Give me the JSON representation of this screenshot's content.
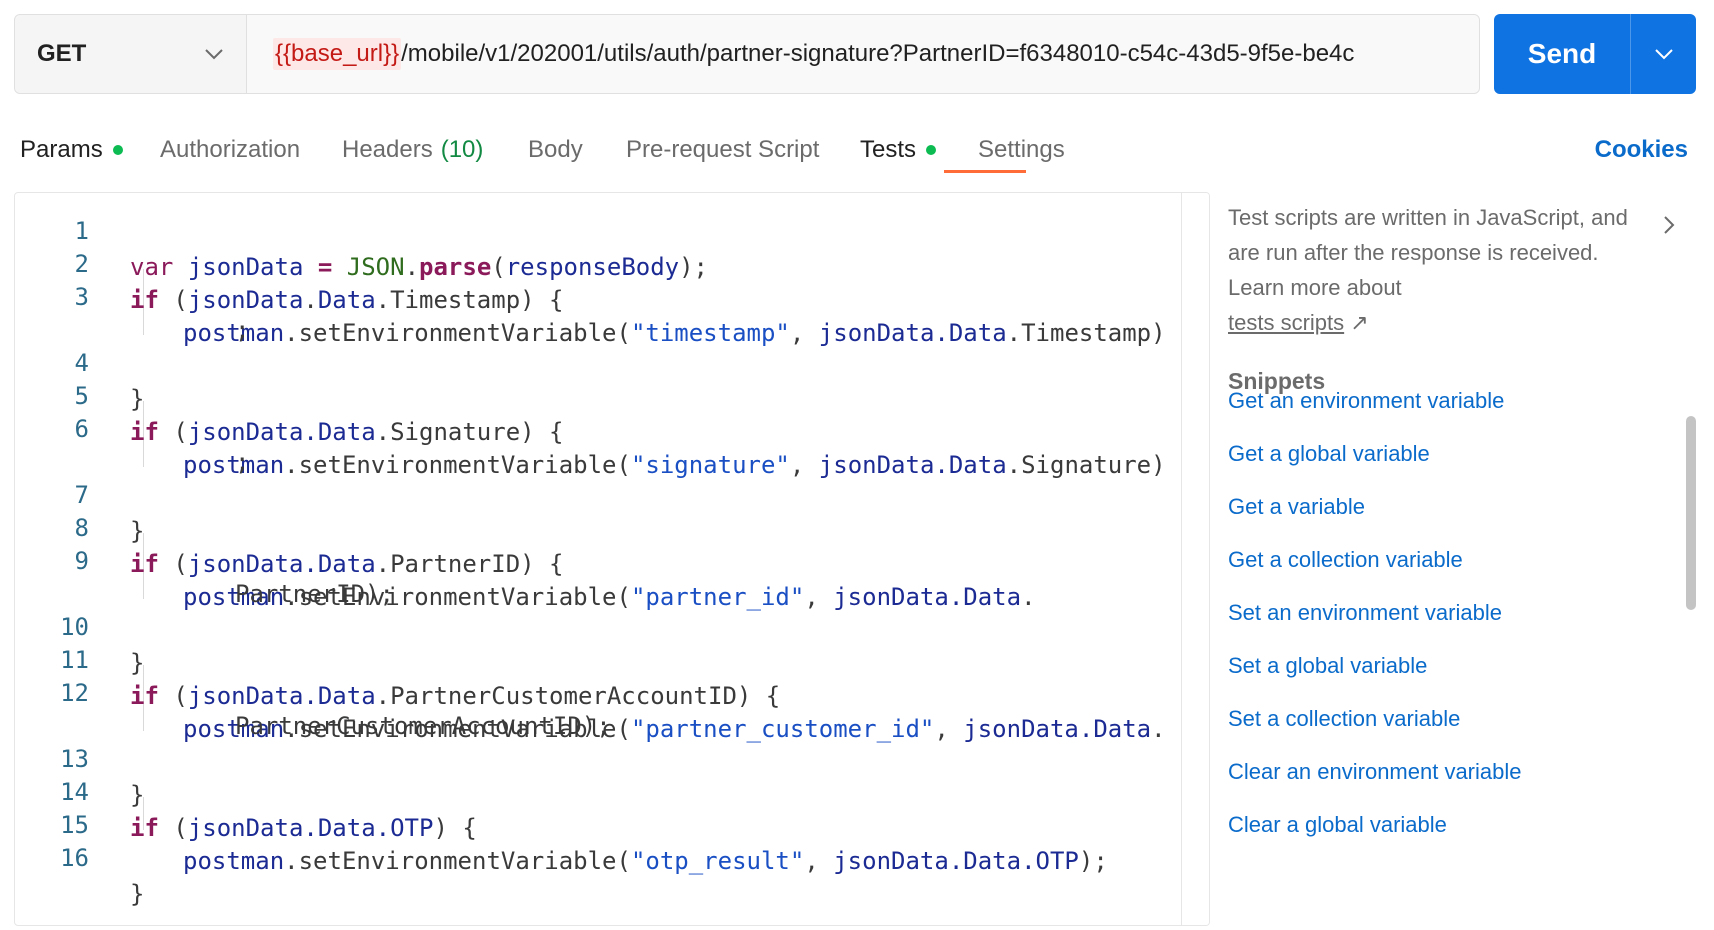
{
  "request": {
    "method": "GET",
    "url_variable": "{{base_url}}",
    "url_path": "/mobile/v1/202001/utils/auth/partner-signature?PartnerID=f6348010-c54c-43d5-9f5e-be4c",
    "send_label": "Send"
  },
  "tabs": [
    {
      "label": "Params",
      "dot": true
    },
    {
      "label": "Authorization"
    },
    {
      "label": "Headers",
      "count": "(10)"
    },
    {
      "label": "Body"
    },
    {
      "label": "Pre-request Script"
    },
    {
      "label": "Tests",
      "dot": true,
      "active": true
    },
    {
      "label": "Settings"
    }
  ],
  "cookies_label": "Cookies",
  "editor": {
    "line_numbers": [
      "1",
      "2",
      "3",
      "4",
      "5",
      "6",
      "7",
      "8",
      "9",
      "10",
      "11",
      "12",
      "13",
      "14",
      "15",
      "16"
    ],
    "lines": {
      "l1": {
        "kw": "var",
        "id": "jsonData",
        "eq": " = ",
        "obj": "JSON",
        "dot": ".",
        "fn": "parse",
        "open": "(",
        "arg": "responseBody",
        "close": ");"
      },
      "l2": {
        "kw": "if",
        "open": " (",
        "id": "jsonData",
        "dot": ".",
        "prop": "Data",
        "rest": ".Timestamp) {"
      },
      "l3": {
        "obj": "postman",
        "fn": ".setEnvironmentVariable(",
        "str": "\"timestamp\"",
        "comma": ", ",
        "id": "jsonData",
        "prop": ".Data",
        "rest": ".Timestamp)"
      },
      "l3b": {
        "text": ";"
      },
      "l4": {
        "text": "}"
      },
      "l5": {
        "kw": "if",
        "open": " (",
        "id": "jsonData",
        "prop": ".Data",
        "rest": ".Signature) {"
      },
      "l6": {
        "obj": "postman",
        "fn": ".setEnvironmentVariable(",
        "str": "\"signature\"",
        "comma": ", ",
        "id": "jsonData",
        "prop": ".Data",
        "rest": ".Signature)"
      },
      "l6b": {
        "text": ";"
      },
      "l7": {
        "text": "}"
      },
      "l8": {
        "kw": "if",
        "open": " (",
        "id": "jsonData",
        "prop": ".Data",
        "rest": ".PartnerID) {"
      },
      "l9": {
        "obj": "postman",
        "fn": ".setEnvironmentVariable(",
        "str": "\"partner_id\"",
        "comma": ", ",
        "id": "jsonData",
        "prop": ".Data",
        "rest": "."
      },
      "l9b": {
        "text": "PartnerID);"
      },
      "l10": {
        "text": "}"
      },
      "l11": {
        "kw": "if",
        "open": " (",
        "id": "jsonData",
        "prop": ".Data",
        "rest": ".PartnerCustomerAccountID) {"
      },
      "l12": {
        "obj": "postman",
        "fn": ".setEnvironmentVariable(",
        "str": "\"partner_customer_id\"",
        "comma": ", ",
        "id": "jsonData",
        "prop": ".Data",
        "rest": "."
      },
      "l12b": {
        "text": "PartnerCustomerAccountID);"
      },
      "l13": {
        "text": "}"
      },
      "l14": {
        "kw": "if",
        "open": " (",
        "id": "jsonData",
        "prop": ".Data",
        "obj2": ".OTP",
        "rest": ") {"
      },
      "l15": {
        "obj": "postman",
        "fn": ".setEnvironmentVariable(",
        "str": "\"otp_result\"",
        "comma": ", ",
        "id": "jsonData",
        "prop": ".Data",
        "obj2": ".OTP",
        "rest": ");"
      },
      "l16": {
        "text": "}"
      }
    }
  },
  "panel": {
    "description": "Test scripts are written in JavaScript, and are run after the response is received. Learn more about",
    "link_label": "tests scripts",
    "link_arrow": "↗",
    "snippets_title": "Snippets",
    "snippets": [
      "Get an environment variable",
      "Get a global variable",
      "Get a variable",
      "Get a collection variable",
      "Set an environment variable",
      "Set a global variable",
      "Set a collection variable",
      "Clear an environment variable",
      "Clear a global variable"
    ]
  }
}
